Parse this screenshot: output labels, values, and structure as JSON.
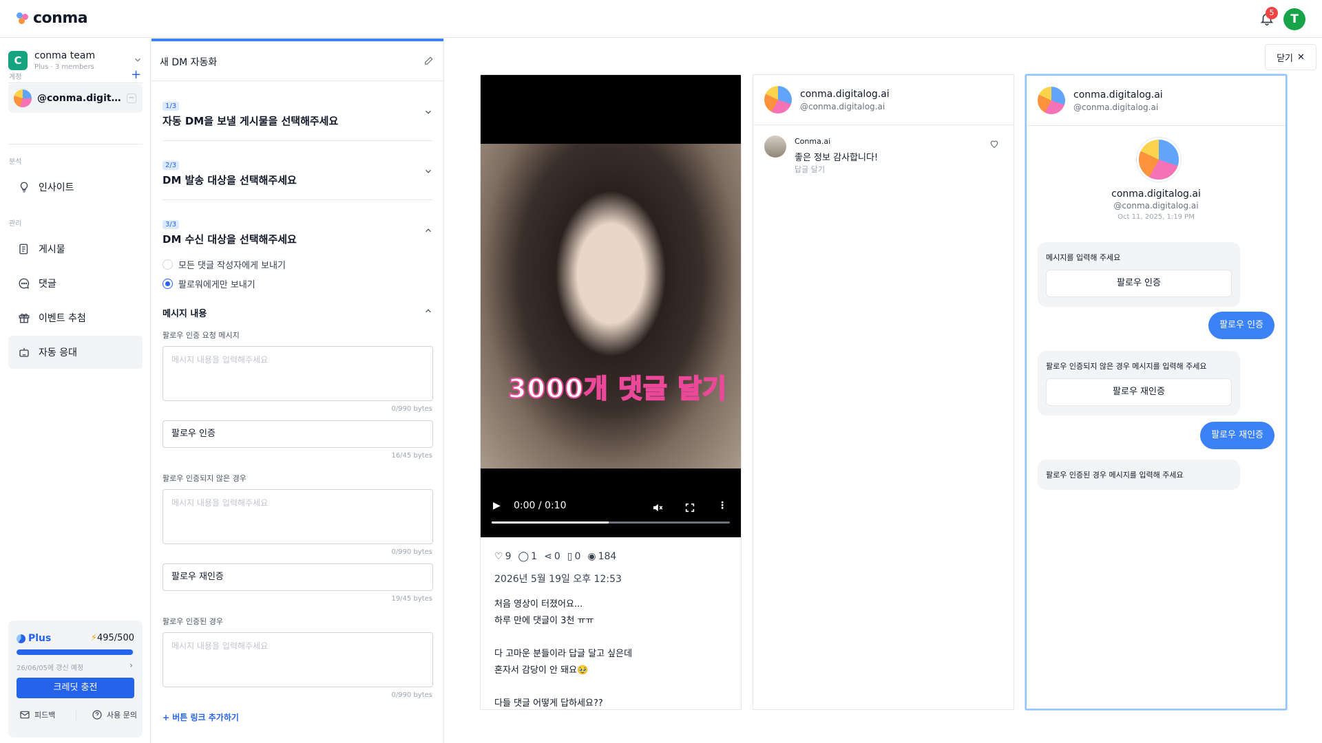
{
  "brand": {
    "logo_text": "conma"
  },
  "header": {
    "notification_count": "5",
    "user_initial": "T"
  },
  "sidebar": {
    "team": {
      "initial": "C",
      "name": "conma team",
      "sub": "Plus · 3 members"
    },
    "section_account": "계정",
    "account": {
      "name": "@conma.digital..."
    },
    "section_analysis": "분석",
    "section_manage": "관리",
    "items": [
      {
        "label": "인사이트",
        "icon": "lightbulb-icon"
      },
      {
        "label": "게시물",
        "icon": "document-icon"
      },
      {
        "label": "댓글",
        "icon": "chat-bubble-icon"
      },
      {
        "label": "이벤트 추첨",
        "icon": "gift-icon"
      },
      {
        "label": "자동 응대",
        "icon": "robot-icon"
      }
    ],
    "plan": {
      "name": "Plus",
      "credits": "495/500",
      "credits_fraction": 0.99,
      "renew": "26/06/05에 갱신 예정",
      "charge_label": "크레딧 충전"
    },
    "footer": {
      "feedback": "피드백",
      "help": "사용 문의"
    }
  },
  "editor": {
    "title": "새 DM 자동화",
    "steps": [
      {
        "badge": "1/3",
        "title": "자동 DM을 보낼 게시물을 선택해주세요"
      },
      {
        "badge": "2/3",
        "title": "DM 발송 대상을 선택해주세요"
      },
      {
        "badge": "3/3",
        "title": "DM 수신 대상을 선택해주세요"
      }
    ],
    "radio_all": "모든 댓글 작성자에게 보내기",
    "radio_followers": "팔로워에게만 보내기",
    "message_heading": "메시지 내용",
    "label_follow_request": "팔로우 인증 요청 메시지",
    "placeholder": "메시지 내용을 입력해주세요",
    "bytes_990": "0/990 bytes",
    "btn1_value": "팔로우 인증",
    "btn1_bytes": "16/45 bytes",
    "label_not_verified": "팔로우 인증되지 않은 경우",
    "btn2_value": "팔로우 재인증",
    "btn2_bytes": "19/45 bytes",
    "label_verified": "팔로우 인증된 경우",
    "add_link": "버튼 링크 추가하기"
  },
  "preview": {
    "close_label": "닫기",
    "video": {
      "caption": "3000개 댓글 달기",
      "time": "0:00 / 0:10",
      "progress_fraction": 0.49
    },
    "stats": {
      "likes": "9",
      "comments": "1",
      "shares": "0",
      "saves": "0",
      "views": "184"
    },
    "post_date": "2026년 5월 19일 오후 12:53",
    "post_body": "처음 영상이 터졌어요...\n하루 만에 댓글이 3천 ㅠㅠ\n\n다 고마운 분들이라 답글 달고 싶은데\n혼자서 감당이 안 돼요🥹\n\n다들 댓글 어떻게 답하세요??",
    "account_name": "conma.digitalog.ai",
    "account_handle": "@conma.digitalog.ai",
    "comment": {
      "author": "Conma.ai",
      "text": "좋은 정보 감사합니다!",
      "reply": "답글 달기"
    },
    "dm": {
      "date": "Oct 11, 2025, 1:19 PM",
      "bubble1": "메시지를 입력해 주세요",
      "bubble1_btn": "팔로우 인증",
      "reply1": "팔로우 인증",
      "bubble2": "팔로우 인증되지 않은 경우 메시지를 입력해 주세요",
      "bubble2_btn": "팔로우 재인증",
      "reply2": "팔로우 재인증",
      "bubble3": "팔로우 인증된 경우 메시지를 입력해 주세요"
    }
  }
}
